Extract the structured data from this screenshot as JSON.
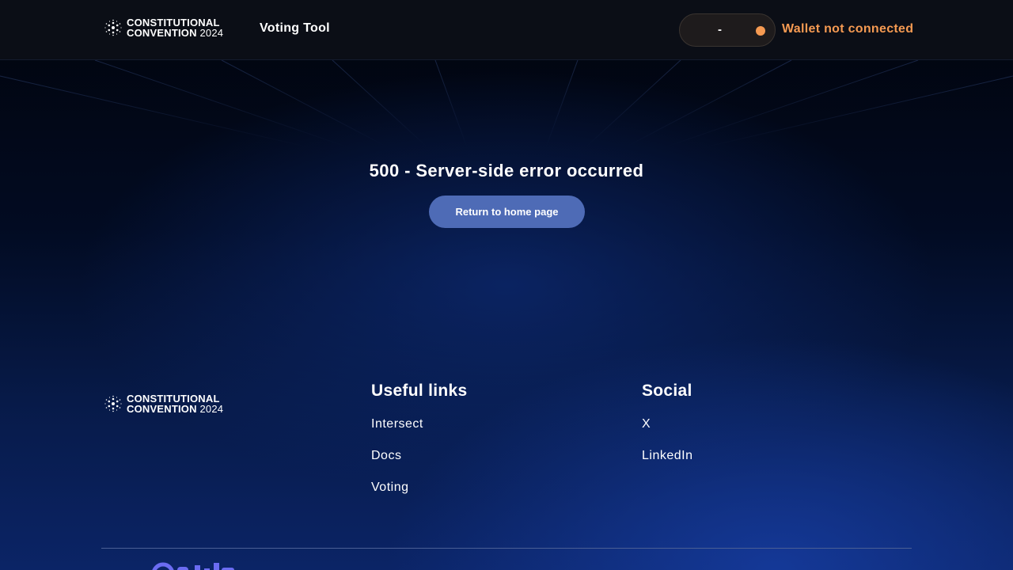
{
  "header": {
    "logo": {
      "line1": "CONSTITUTIONAL",
      "line2_word": "CONVENTION",
      "line2_year": "2024"
    },
    "nav_title": "Voting Tool",
    "wallet": {
      "balance_placeholder": "-",
      "status": "Wallet not connected",
      "status_color": "#f59a52"
    }
  },
  "main": {
    "error_title": "500 - Server-side error occurred",
    "home_button_label": "Return to home page",
    "button_color": "#4e6bb6"
  },
  "footer": {
    "logo": {
      "line1": "CONSTITUTIONAL",
      "line2_word": "CONVENTION",
      "line2_year": "2024"
    },
    "useful_links": {
      "title": "Useful links",
      "items": [
        "Intersect",
        "Docs",
        "Voting"
      ]
    },
    "social": {
      "title": "Social",
      "items": [
        "X",
        "LinkedIn"
      ]
    },
    "partner_logo_icon": "partner-logo-icon"
  }
}
